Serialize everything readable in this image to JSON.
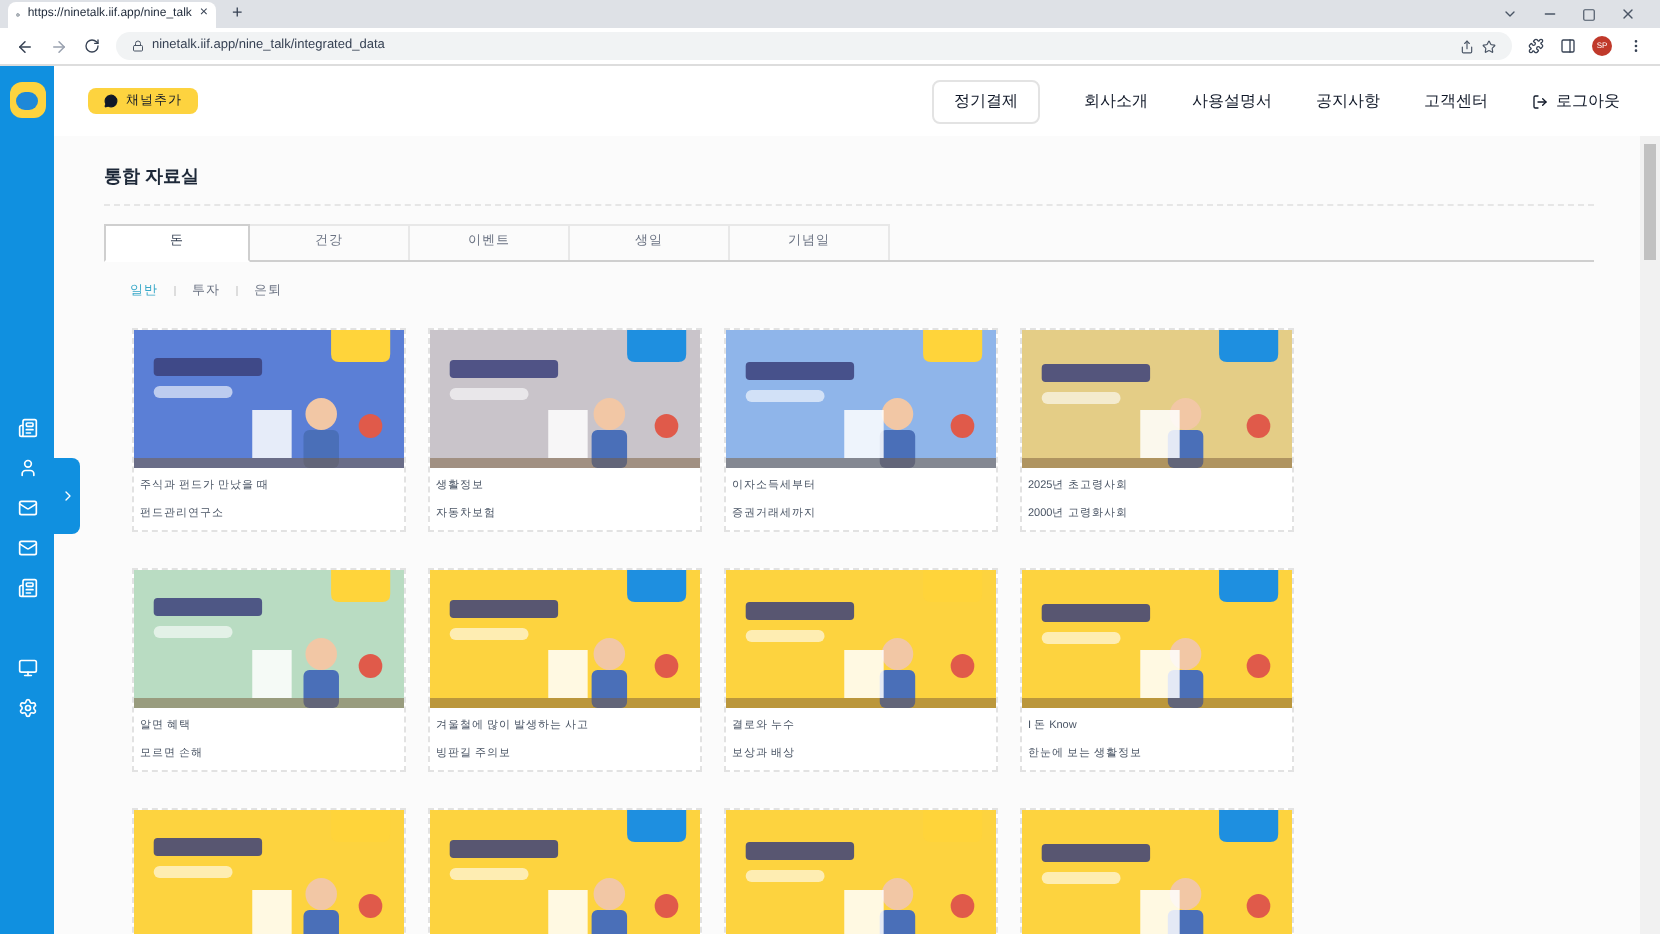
{
  "browser": {
    "tab_title": "https://ninetalk.iif.app/nine_talk",
    "new_tab": "+",
    "close": "×",
    "address": "ninetalk.iif.app/nine_talk/integrated_data",
    "profile": "SP"
  },
  "header": {
    "channel_button": "채널추가",
    "payment_button": "정기결제",
    "nav": [
      "회사소개",
      "사용설명서",
      "공지사항",
      "고객센터"
    ],
    "logout": "로그아웃"
  },
  "page": {
    "title": "통합 자료실",
    "tabs": [
      {
        "label": "돈",
        "selected": true
      },
      {
        "label": "건강",
        "selected": false
      },
      {
        "label": "이벤트",
        "selected": false
      },
      {
        "label": "생일",
        "selected": false
      },
      {
        "label": "기념일",
        "selected": false
      }
    ],
    "subtabs": [
      {
        "label": "일반",
        "selected": true
      },
      {
        "label": "투자",
        "selected": false
      },
      {
        "label": "은퇴",
        "selected": false
      }
    ],
    "cards": [
      {
        "color": "#5b7fd6",
        "line1": "주식과 펀드가 만났을 때",
        "line2": "펀드관리연구소"
      },
      {
        "color": "#c9c4ca",
        "line1": "생활정보",
        "line2": "자동차보험"
      },
      {
        "color": "#8fb5ea",
        "line1": "이자소득세부터",
        "line2": "증권거래세까지"
      },
      {
        "color": "#e4cd86",
        "line1": "2025년 초고령사회",
        "line2": "2000년 고령화사회"
      },
      {
        "color": "#b9dcc2",
        "line1": "알면 혜택",
        "line2": "모르면 손해"
      },
      {
        "color": "#fdd33f",
        "line1": "겨울철에 많이 발생하는 사고",
        "line2": "빙판길 주의보"
      },
      {
        "color": "#fdd33f",
        "line1": "결로와 누수",
        "line2": "보상과 배상"
      },
      {
        "color": "#fdd33f",
        "line1": "I 돈 Know",
        "line2": "한눈에 보는 생활정보"
      },
      {
        "color": "#fdd33f"
      },
      {
        "color": "#fdd33f"
      },
      {
        "color": "#fdd33f"
      },
      {
        "color": "#fdd33f"
      }
    ]
  }
}
